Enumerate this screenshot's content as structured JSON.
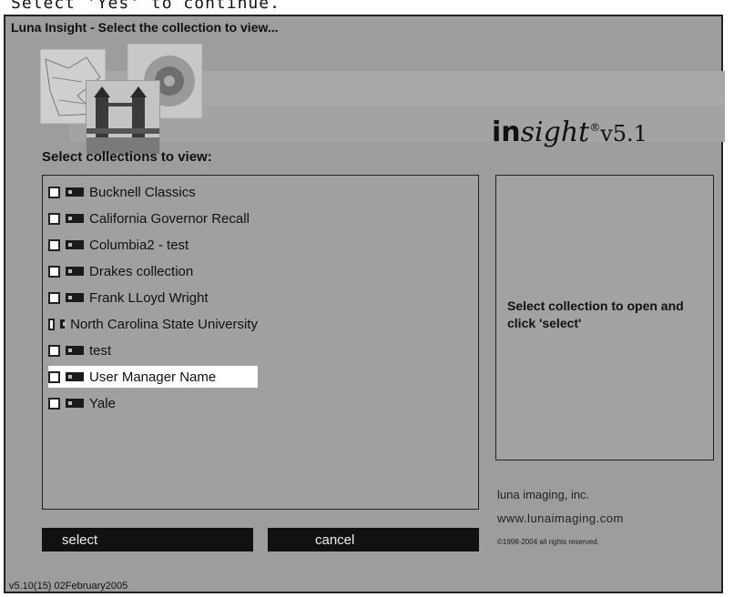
{
  "caption": "Select 'Yes' to continue.",
  "window": {
    "title": "Luna Insight - Select the collection to view..."
  },
  "logo": {
    "brand_bold": "in",
    "brand_italic": "sight",
    "registered": "®",
    "version": "v5.1"
  },
  "collections": {
    "heading": "Select collections to view:",
    "items": [
      {
        "label": "Bucknell Classics",
        "checked": false
      },
      {
        "label": "California Governor Recall",
        "checked": false
      },
      {
        "label": "Columbia2 - test",
        "checked": false
      },
      {
        "label": "Drakes collection",
        "checked": false
      },
      {
        "label": "Frank LLoyd Wright",
        "checked": false
      },
      {
        "label": "North Carolina State University",
        "checked": false
      },
      {
        "label": "test",
        "checked": false
      },
      {
        "label": "User Manager Name",
        "checked": false,
        "highlighted": true
      },
      {
        "label": "Yale",
        "checked": false
      }
    ]
  },
  "info_panel": {
    "text": "Select collection to open and click 'select'"
  },
  "footer_info": {
    "company": "luna imaging, inc.",
    "website": "www.lunaimaging.com",
    "copyright": "©1998-2004 all rights reserved."
  },
  "buttons": {
    "select_label": "select",
    "cancel_label": "cancel"
  },
  "status": {
    "version": "v5.10(15) 02February2005"
  },
  "colors": {
    "window_bg": "#9d9d9d",
    "button_bg": "#111111",
    "highlight_bg": "#ffffff"
  }
}
